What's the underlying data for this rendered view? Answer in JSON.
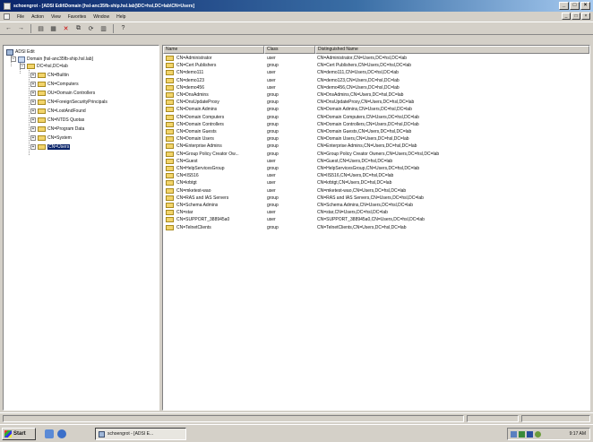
{
  "window": {
    "title": "schoengrot - [ADSI Edit\\Domain [hsl-anc35fb-ship.hsl.lab]\\DC=hsl,DC=lab\\CN=Users]",
    "min": "_",
    "max": "□",
    "close": "×"
  },
  "menu": [
    "File",
    "Action",
    "View",
    "Favorites",
    "Window",
    "Help"
  ],
  "inner_controls": {
    "min": "_",
    "max": "□",
    "close": "×"
  },
  "toolbar": {
    "back": "←",
    "forward": "→",
    "up": "▤",
    "properties": "▦",
    "delete": "✕",
    "copy": "⧉",
    "refresh": "⟳",
    "export": "▥",
    "help": "?"
  },
  "tree": {
    "root": "ADSI Edit",
    "domain": "Domain [hsl-anc35fb-ship.hsl.lab]",
    "dc": "DC=hsl,DC=lab",
    "expand_plus": "+",
    "expand_minus": "−",
    "children": [
      "CN=Builtin",
      "CN=Computers",
      "OU=Domain Controllers",
      "CN=ForeignSecurityPrincipals",
      "CN=LostAndFound",
      "CN=NTDS Quotas",
      "CN=Program Data",
      "CN=System",
      "CN=Users"
    ]
  },
  "list": {
    "headers": [
      "Name",
      "Class",
      "Distinguished Name"
    ],
    "rows": [
      [
        "CN=Administrator",
        "user",
        "CN=Administrator,CN=Users,DC=hsl,DC=lab"
      ],
      [
        "CN=Cert Publishers",
        "group",
        "CN=Cert Publishers,CN=Users,DC=hsl,DC=lab"
      ],
      [
        "CN=demo111",
        "user",
        "CN=demo111,CN=Users,DC=hsl,DC=lab"
      ],
      [
        "CN=demo123",
        "user",
        "CN=demo123,CN=Users,DC=hsl,DC=lab"
      ],
      [
        "CN=demo456",
        "user",
        "CN=demo456,CN=Users,DC=hsl,DC=lab"
      ],
      [
        "CN=DnsAdmins",
        "group",
        "CN=DnsAdmins,CN=Users,DC=hsl,DC=lab"
      ],
      [
        "CN=DnsUpdateProxy",
        "group",
        "CN=DnsUpdateProxy,CN=Users,DC=hsl,DC=lab"
      ],
      [
        "CN=Domain Admins",
        "group",
        "CN=Domain Admins,CN=Users,DC=hsl,DC=lab"
      ],
      [
        "CN=Domain Computers",
        "group",
        "CN=Domain Computers,CN=Users,DC=hsl,DC=lab"
      ],
      [
        "CN=Domain Controllers",
        "group",
        "CN=Domain Controllers,CN=Users,DC=hsl,DC=lab"
      ],
      [
        "CN=Domain Guests",
        "group",
        "CN=Domain Guests,CN=Users,DC=hsl,DC=lab"
      ],
      [
        "CN=Domain Users",
        "group",
        "CN=Domain Users,CN=Users,DC=hsl,DC=lab"
      ],
      [
        "CN=Enterprise Admins",
        "group",
        "CN=Enterprise Admins,CN=Users,DC=hsl,DC=lab"
      ],
      [
        "CN=Group Policy Creator Ow...",
        "group",
        "CN=Group Policy Creator Owners,CN=Users,DC=hsl,DC=lab"
      ],
      [
        "CN=Guest",
        "user",
        "CN=Guest,CN=Users,DC=hsl,DC=lab"
      ],
      [
        "CN=HelpServicesGroup",
        "group",
        "CN=HelpServicesGroup,CN=Users,DC=hsl,DC=lab"
      ],
      [
        "CN=IIS516",
        "user",
        "CN=IIS516,CN=Users,DC=hsl,DC=lab"
      ],
      [
        "CN=krbtgt",
        "user",
        "CN=krbtgt,CN=Users,DC=hsl,DC=lab"
      ],
      [
        "CN=mketest-wao",
        "user",
        "CN=mketest-wao,CN=Users,DC=hsl,DC=lab"
      ],
      [
        "CN=RAS and IAS Servers",
        "group",
        "CN=RAS and IAS Servers,CN=Users,DC=hsl,DC=lab"
      ],
      [
        "CN=Schema Admins",
        "group",
        "CN=Schema Admins,CN=Users,DC=hsl,DC=lab"
      ],
      [
        "CN=star",
        "user",
        "CN=star,CN=Users,DC=hsl,DC=lab"
      ],
      [
        "CN=SUPPORT_388945a0",
        "user",
        "CN=SUPPORT_388945a0,CN=Users,DC=hsl,DC=lab"
      ],
      [
        "CN=TelnetClients",
        "group",
        "CN=TelnetClients,CN=Users,DC=hsl,DC=lab"
      ]
    ]
  },
  "taskbar": {
    "start": "Start",
    "task": "schoengrot - [ADSI E...",
    "clock": "9:17 AM"
  },
  "colors": {
    "title_active": "#0a246a",
    "selection": "#0a246a",
    "folder": "#f2d46b",
    "face": "#d4d0c8"
  }
}
